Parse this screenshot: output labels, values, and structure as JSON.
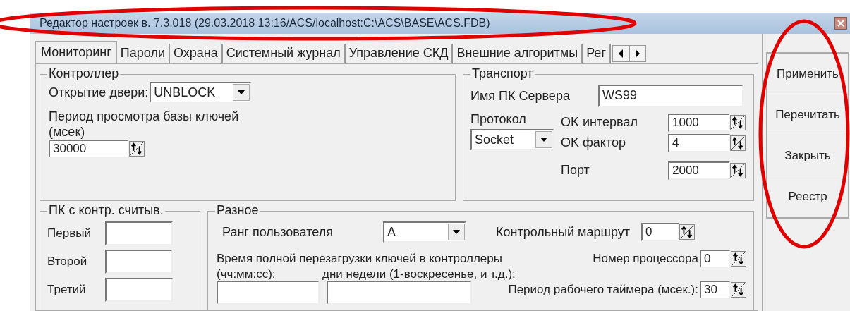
{
  "window": {
    "title": "Редактор настроек в. 7.3.018 (29.03.2018 13:16/ACS/localhost:C:\\ACS\\BASE\\ACS.FDB)"
  },
  "tabs": [
    {
      "label": "Мониторинг",
      "selected": true
    },
    {
      "label": "Пароли",
      "selected": false
    },
    {
      "label": "Охрана",
      "selected": false
    },
    {
      "label": "Системный журнал",
      "selected": false
    },
    {
      "label": "Управление СКД",
      "selected": false
    },
    {
      "label": "Внешние алгоритмы",
      "selected": false
    },
    {
      "label": "Рег",
      "selected": false
    }
  ],
  "controller": {
    "title": "Контроллер",
    "door_label": "Открытие двери:",
    "door_value": "UNBLOCK",
    "period_label": "Период просмотра базы ключей\n(мсек)",
    "period_value": "30000"
  },
  "transport": {
    "title": "Транспорт",
    "server_label": "Имя ПК Сервера",
    "server_value": "WS99",
    "protocol_label": "Протокол",
    "protocol_value": "Socket",
    "spins": [
      {
        "label": "OK интервал",
        "value": "1000"
      },
      {
        "label": "OK фактор",
        "value": "4"
      },
      {
        "label": "Порт",
        "value": "2000"
      }
    ]
  },
  "readers": {
    "title": "ПК с контр. считыв.",
    "fields": [
      "Первый",
      "Второй",
      "Третий"
    ]
  },
  "misc": {
    "title": "Разное",
    "rank_label": "Ранг пользователя",
    "rank_value": "A",
    "route_label": "Контрольный маршрут",
    "route_value": "0",
    "reload_label": "Время полной перезагрузки ключей в контроллеры",
    "time_label": "(чч:мм:сс):",
    "days_label": "дни недели (1-воскресенье, и т.д.):",
    "cpu_label": "Номер процессора",
    "cpu_value": "0",
    "timer_label": "Период рабочего таймера (мсек.):",
    "timer_value": "30"
  },
  "buttons": [
    "Применить",
    "Перечитать",
    "Закрыть",
    "Реестр"
  ],
  "annotations": [
    {
      "kind": "ellipse"
    },
    {
      "kind": "ellipse"
    }
  ]
}
